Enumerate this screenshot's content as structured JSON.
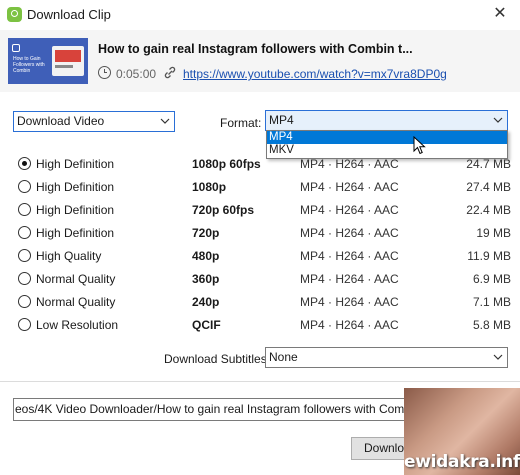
{
  "window": {
    "title": "Download Clip",
    "close_glyph": "✕",
    "accent_color": "#7cc242"
  },
  "clip": {
    "title": "How to gain real Instagram followers with Combin t...",
    "duration": "0:05:00",
    "url": "https://www.youtube.com/watch?v=mx7vra8DP0g",
    "thumbnail_text": "How to Gain Followers with Combin"
  },
  "download_type": {
    "value": "Download Video"
  },
  "format": {
    "label": "Format:",
    "value": "MP4",
    "options": [
      "MP4",
      "MKV"
    ]
  },
  "qualities": [
    {
      "label": "High Definition",
      "resolution": "1080p 60fps",
      "codec": "MP4 · H264 · AAC",
      "size": "24.7 MB",
      "selected": true
    },
    {
      "label": "High Definition",
      "resolution": "1080p",
      "codec": "MP4 · H264 · AAC",
      "size": "27.4 MB",
      "selected": false
    },
    {
      "label": "High Definition",
      "resolution": "720p 60fps",
      "codec": "MP4 · H264 · AAC",
      "size": "22.4 MB",
      "selected": false
    },
    {
      "label": "High Definition",
      "resolution": "720p",
      "codec": "MP4 · H264 · AAC",
      "size": "19 MB",
      "selected": false
    },
    {
      "label": "High Quality",
      "resolution": "480p",
      "codec": "MP4 · H264 · AAC",
      "size": "11.9 MB",
      "selected": false
    },
    {
      "label": "Normal Quality",
      "resolution": "360p",
      "codec": "MP4 · H264 · AAC",
      "size": "6.9 MB",
      "selected": false
    },
    {
      "label": "Normal Quality",
      "resolution": "240p",
      "codec": "MP4 · H264 · AAC",
      "size": "7.1 MB",
      "selected": false
    },
    {
      "label": "Low Resolution",
      "resolution": "QCIF",
      "codec": "MP4 · H264 · AAC",
      "size": "5.8 MB",
      "selected": false
    }
  ],
  "subtitles": {
    "label": "Download Subtitles:",
    "value": "None"
  },
  "save_path": {
    "value": "eos/4K Video Downloader/How to gain real Instagram followers with Combin tool."
  },
  "actions": {
    "download_label": "Download"
  },
  "overlay": {
    "watermark": "ewidakra.info"
  }
}
